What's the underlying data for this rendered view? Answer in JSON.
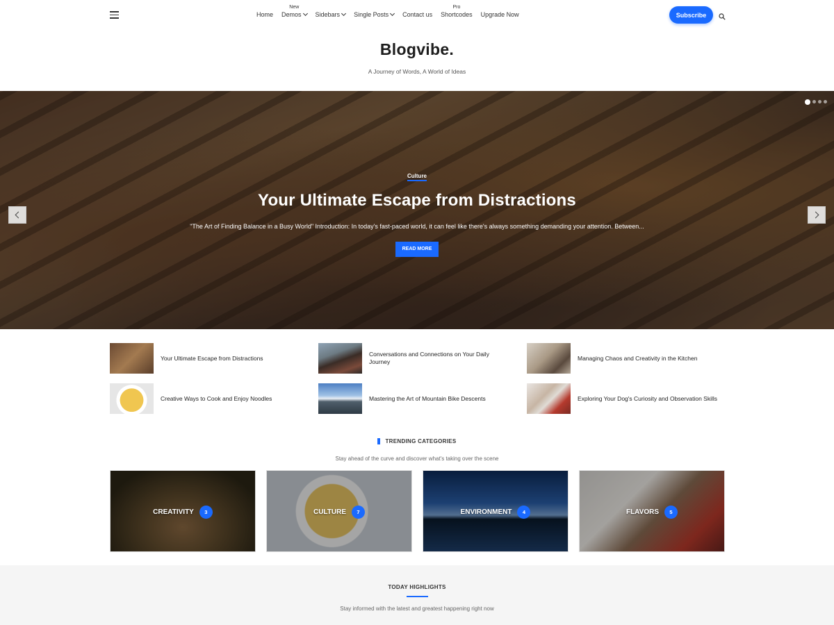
{
  "header": {
    "menu_icon": "hamburger-icon",
    "nav": [
      {
        "label": "Home",
        "badge": "",
        "dropdown": false
      },
      {
        "label": "Demos",
        "badge": "New",
        "dropdown": true
      },
      {
        "label": "Sidebars",
        "badge": "",
        "dropdown": true
      },
      {
        "label": "Single Posts",
        "badge": "",
        "dropdown": true
      },
      {
        "label": "Contact us",
        "badge": "",
        "dropdown": false
      },
      {
        "label": "Shortcodes",
        "badge": "Pro",
        "dropdown": false
      },
      {
        "label": "Upgrade Now",
        "badge": "",
        "dropdown": false
      }
    ],
    "subscribe_label": "Subscribe",
    "search_icon": "search-icon"
  },
  "brand": {
    "title": "Blogvibe.",
    "tagline": "A Journey of Words, A World of Ideas"
  },
  "hero": {
    "category": "Culture",
    "title": "Your Ultimate Escape from Distractions",
    "excerpt": "\"The Art of Finding Balance in a Busy World\" Introduction: In today's fast-paced world, it can feel like there's always something demanding your attention. Between...",
    "button_label": "READ MORE",
    "slide_count": 4,
    "active_slide": 1
  },
  "posts": [
    {
      "title": "Your Ultimate Escape from Distractions",
      "thumb": "library"
    },
    {
      "title": "Conversations and Connections on Your Daily Journey",
      "thumb": "train"
    },
    {
      "title": "Managing Chaos and Creativity in the Kitchen",
      "thumb": "kitchen"
    },
    {
      "title": "Creative Ways to Cook and Enjoy Noodles",
      "thumb": "noodles"
    },
    {
      "title": "Mastering the Art of Mountain Bike Descents",
      "thumb": "mountain"
    },
    {
      "title": "Exploring Your Dog's Curiosity and Observation Skills",
      "thumb": "dog"
    }
  ],
  "trending": {
    "title": "TRENDING CATEGORIES",
    "subtitle": "Stay ahead of the curve and discover what's taking over the scene",
    "categories": [
      {
        "name": "Creativity",
        "count": "3"
      },
      {
        "name": "Culture",
        "count": "7"
      },
      {
        "name": "Environment",
        "count": "4"
      },
      {
        "name": "Flavors",
        "count": "5"
      }
    ]
  },
  "highlights": {
    "title": "TODAY HIGHLIGHTS",
    "subtitle": "Stay informed with the latest and greatest happening right now"
  },
  "colors": {
    "accent": "#1a6aff",
    "text": "#222222",
    "muted": "#666666",
    "section_bg": "#f5f5f5"
  }
}
